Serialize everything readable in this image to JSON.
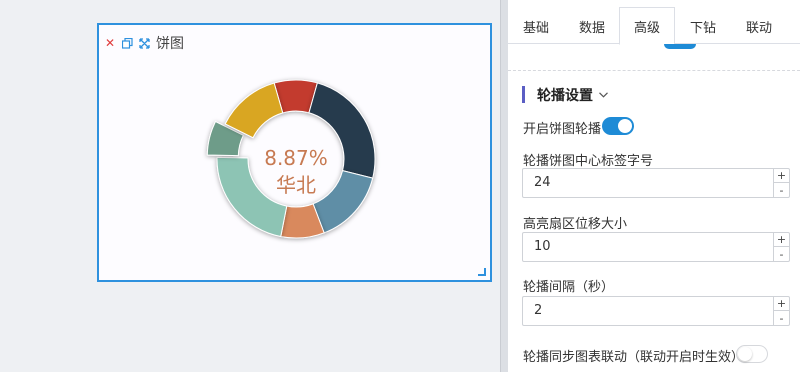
{
  "widget": {
    "title": "饼图",
    "center_percent": "8.87%",
    "center_label": "华北",
    "center_color": "#c77a52"
  },
  "chart_data": {
    "type": "pie",
    "variant": "donut",
    "highlighted_index": 5,
    "center_label": "华北",
    "center_value": "8.87%",
    "series": [
      {
        "name": "",
        "values": [
          8.8,
          24.5,
          15.3,
          8.87,
          22.2,
          7.0,
          13.2
        ]
      }
    ],
    "colors": [
      "#c33a2e",
      "#283a4e",
      "#5e8ea6",
      "#d9895d",
      "#8dc4b4",
      "#6e9c89",
      "#d9a620"
    ]
  },
  "tabs": [
    {
      "label": "基础"
    },
    {
      "label": "数据"
    },
    {
      "label": "高级"
    },
    {
      "label": "下钻"
    },
    {
      "label": "联动"
    }
  ],
  "active_tab": "高级",
  "section": {
    "title": "轮播设置",
    "expanded": true
  },
  "settings": {
    "enable_label": "开启饼图轮播",
    "enable_on": true,
    "font_size_label": "轮播饼图中心标签字号",
    "font_size_value": "24",
    "offset_label": "高亮扇区位移大小",
    "offset_value": "10",
    "interval_label": "轮播间隔（秒）",
    "interval_value": "2",
    "sync_label": "轮播同步图表联动（联动开启时生效）",
    "sync_on": false
  },
  "stepper": {
    "up": "+",
    "down": "-"
  },
  "icons": {
    "close": "close-icon",
    "copy": "copy-icon",
    "expand": "expand-icon",
    "chevron": "chevron-down-icon",
    "resize": "resize-handle-icon"
  },
  "accent": "#2e91de",
  "switch_color": "#1e8bd6"
}
